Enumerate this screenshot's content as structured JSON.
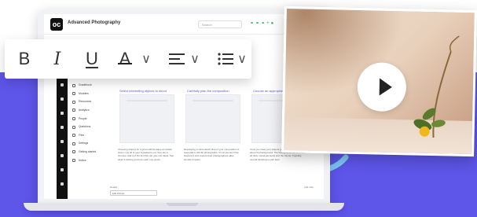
{
  "app": {
    "title": "Advanced Photography",
    "logo_text": "oc",
    "search_placeholder": "Search",
    "header_icons": [
      "link-icon",
      "link-icon",
      "link-icon",
      "plus-icon",
      "avatar-icon"
    ]
  },
  "sidebar_menu": [
    {
      "label": "Welcome",
      "icon": "home-icon"
    },
    {
      "label": "Assignments",
      "icon": "assignment-icon"
    },
    {
      "label": "Gradebook",
      "icon": "gradebook-icon"
    },
    {
      "label": "Modules",
      "icon": "modules-icon"
    },
    {
      "label": "Resources",
      "icon": "resources-icon"
    },
    {
      "label": "Analytics",
      "icon": "analytics-icon"
    },
    {
      "label": "People",
      "icon": "people-icon"
    },
    {
      "label": "Questions",
      "icon": "question-icon"
    },
    {
      "label": "Files",
      "icon": "files-icon"
    },
    {
      "label": "Settings",
      "icon": "settings-icon"
    },
    {
      "label": "Getting started",
      "icon": "start-icon"
    },
    {
      "label": "Notice",
      "icon": "notice-icon"
    }
  ],
  "columns": [
    {
      "heading": "Select interesting objects to shoot",
      "text": "Choosing objects for a great still life takes an artistic vision. Lay all of your ingredients out; they are a sources. Add it of the first flat can give you ideas. See what is striking and how each one works."
    },
    {
      "heading": "Carefully plan the composition",
      "text": "Developing a solid sketch idea of your composition is essential to still life photographs. It's an element that beginners and experienced photographers alike should consider."
    },
    {
      "heading": "Choose an appropriate",
      "text": "Once you have your objects you can begin to think about the background. The background has to fit with all other visual elements and the theme. Typically, neutral backdrops work best."
    }
  ],
  "lower": {
    "subhead": "Details",
    "select_value": "Edit Picture",
    "corner_label": "Add note"
  },
  "toolbar": {
    "bold": "B",
    "italic": "I",
    "underline": "U",
    "text_color": "A",
    "chevron": "∨"
  },
  "video": {
    "play_label": "Play video"
  },
  "colors": {
    "band": "#5e55e9",
    "accent_green": "#2db36a",
    "curve": "#7ec8f4"
  }
}
